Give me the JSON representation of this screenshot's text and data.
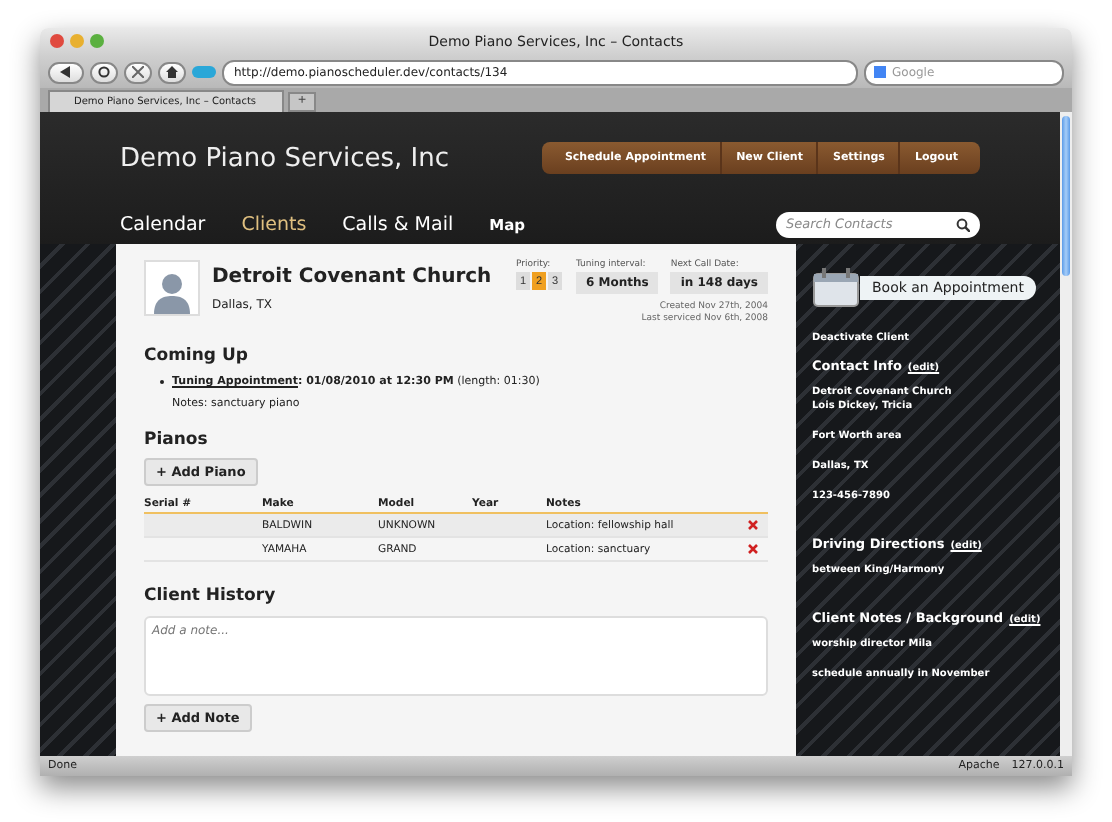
{
  "browser": {
    "title": "Demo Piano Services, Inc – Contacts",
    "url": "http://demo.pianoscheduler.dev/contacts/134",
    "search_placeholder": "Google",
    "tab": "Demo Piano Services, Inc – Contacts",
    "tab_add": "+",
    "status": "Done",
    "status_items": [
      "Apache",
      "127.0.0.1"
    ]
  },
  "header": {
    "brand": "Demo Piano Services, Inc",
    "actions": [
      "Schedule Appointment",
      "New Client",
      "Settings",
      "Logout"
    ],
    "nav": [
      {
        "label": "Calendar",
        "selected": false
      },
      {
        "label": "Clients",
        "selected": true
      },
      {
        "label": "Calls & Mail",
        "selected": false
      },
      {
        "label": "Map",
        "selected": false
      }
    ],
    "search_placeholder": "Search Contacts"
  },
  "client": {
    "name": "Detroit Covenant Church",
    "location": "Dallas, TX",
    "priority": {
      "label": "Priority:",
      "options": [
        {
          "label": "1",
          "selected": false
        },
        {
          "label": "2",
          "selected": true
        },
        {
          "label": "3",
          "selected": false
        }
      ]
    },
    "tuning": {
      "label": "Tuning interval:",
      "value": "6 Months"
    },
    "next_call": {
      "label": "Next Call Date:",
      "value": "in 148 days"
    },
    "created": "Created Nov 27th, 2004",
    "serviced": "Last serviced Nov 6th, 2008"
  },
  "coming_up": {
    "heading": "Coming Up",
    "appointments": [
      {
        "link": "Tuning Appointment",
        "detail": "**: 01/08/2010 at 12:30 PM** (length: 01:30)",
        "notes": "Notes: sanctuary piano"
      }
    ]
  },
  "pianos": {
    "heading": "Pianos",
    "add": "+ Add Piano",
    "columns": [
      "Serial #",
      "Make",
      "Model",
      "Year",
      "Notes"
    ],
    "rows": [
      {
        "make": "BALDWIN",
        "model": "UNKNOWN",
        "notes": "Location: fellowship hall"
      },
      {
        "make": "YAMAHA",
        "model": "GRAND",
        "notes": "Location: sanctuary"
      }
    ]
  },
  "history": {
    "heading": "Client History",
    "placeholder": "Add a note...",
    "add": "+ Add Note"
  },
  "sidebar": {
    "book": "Book an Appointment",
    "deactivate": "Deactivate Client",
    "sections": [
      {
        "heading": "Contact Info",
        "edit": "(edit)",
        "lines": [
          "Detroit Covenant Church\nLois Dickey, Tricia",
          "Fort Worth area",
          "Dallas, TX",
          "123-456-7890"
        ]
      },
      {
        "heading": "Driving Directions",
        "edit": "(edit)",
        "lines": [
          "between King/Harmony"
        ]
      },
      {
        "heading": "Client Notes / Background",
        "edit": "(edit)",
        "lines": [
          "worship director Mila",
          "schedule annually in November"
        ]
      }
    ]
  }
}
